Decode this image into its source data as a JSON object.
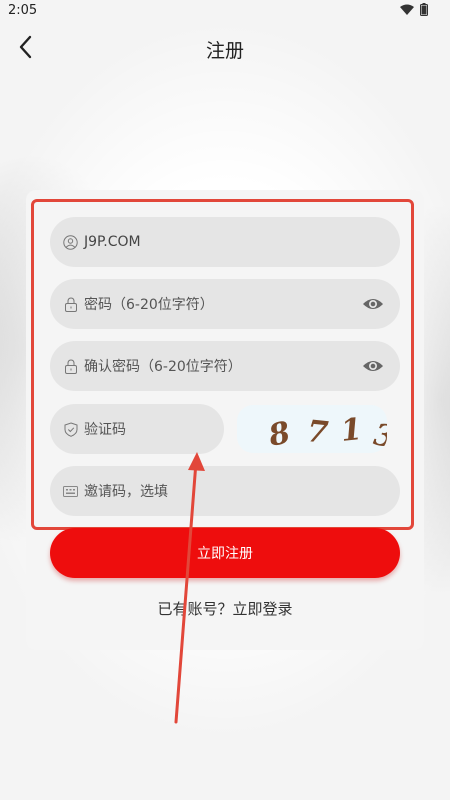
{
  "status_bar": {
    "time": "2:05"
  },
  "header": {
    "title": "注册"
  },
  "form": {
    "username": {
      "value": "J9P.COM"
    },
    "password": {
      "placeholder": "密码（6-20位字符）"
    },
    "confirm_password": {
      "placeholder": "确认密码（6-20位字符）"
    },
    "captcha": {
      "placeholder": "验证码",
      "image_chars": [
        "8",
        "7",
        "1",
        "3"
      ]
    },
    "invite_code": {
      "placeholder": "邀请码，选填"
    }
  },
  "submit": {
    "label": "立即注册"
  },
  "login_link": {
    "label": "已有账号？立即登录"
  },
  "colors": {
    "accent": "#ee0d0d",
    "highlight": "#e2473a",
    "field_bg": "#e5e5e5"
  }
}
